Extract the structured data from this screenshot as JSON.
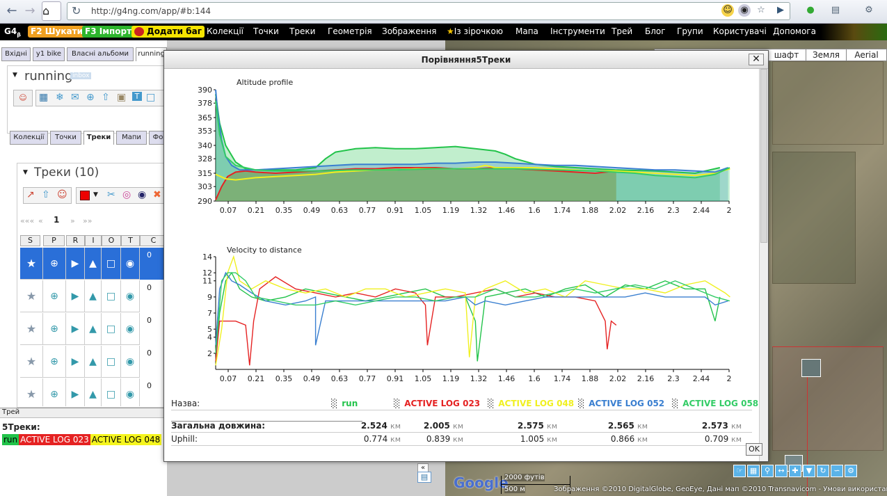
{
  "browser": {
    "url": "http://g4ng.com/app/#b:144"
  },
  "menubar": {
    "logo": "G4",
    "logo_sub": "β",
    "search_badge": "F2 Шукати",
    "import_badge": "F3 Імпорт",
    "bug_badge": "Додати баг",
    "items": [
      "Колекції",
      "Точки",
      "Треки",
      "Геометрія",
      "Зображення",
      "Із зірочкою",
      "Мапа",
      "Інструменти",
      "Трей",
      "Блог",
      "Групи",
      "Користувачі",
      "Допомога"
    ]
  },
  "left": {
    "top_tabs": [
      "Вхідні",
      "y1 bike",
      "Власні альбоми",
      "running"
    ],
    "album_title": "running",
    "album_tag": "inbox",
    "sub_tabs": [
      "Колекції",
      "Точки",
      "Треки",
      "Мапи",
      "Фо"
    ],
    "tracks_title": "Треки (10)",
    "pager": {
      "first": "«««",
      "prev": "«",
      "page": "1",
      "next": "»",
      "last": "»»"
    },
    "columns": [
      "S",
      "P",
      "R",
      "I",
      "O",
      "T",
      "C"
    ],
    "rows": [
      {
        "c": "0"
      },
      {
        "c": "0"
      },
      {
        "c": "0"
      },
      {
        "c": "0"
      },
      {
        "c": "0"
      }
    ]
  },
  "tray": {
    "header": "Трей",
    "title": "5Треки:",
    "chips": [
      {
        "label": "run",
        "color": "#22c34a"
      },
      {
        "label": "ACTIVE LOG 023",
        "color": "#e52222"
      },
      {
        "label": "ACTIVE LOG 048",
        "color": "#f5f51e"
      }
    ]
  },
  "map": {
    "types": [
      "шафт",
      "Земля",
      "Aerial"
    ],
    "scale_ft": "2000 футів",
    "scale_m": "500 м",
    "copyright": "Зображення ©2010 DigitalGlobe, GeoEye, Дані мап ©2010 Transnavicom - Умови використання",
    "google": "Google"
  },
  "dialog": {
    "title": "Порівняння5Треки",
    "close_glyph": "✕",
    "ok_label": "OK",
    "name_label": "Назва:",
    "length_label": "Загальна довжина:",
    "uphill_label": "Uphill:",
    "tracks": [
      {
        "name": "run",
        "color": "#22c34a",
        "length": "2.524",
        "length_unit": "км",
        "uphill": "0.774",
        "uphill_unit": "км"
      },
      {
        "name": "ACTIVE LOG 023",
        "color": "#e52222",
        "length": "2.005",
        "length_unit": "км",
        "uphill": "0.839",
        "uphill_unit": "км"
      },
      {
        "name": "ACTIVE LOG 048",
        "color": "#f0f020",
        "length": "2.575",
        "length_unit": "км",
        "uphill": "1.005",
        "uphill_unit": "км"
      },
      {
        "name": "ACTIVE LOG 052",
        "color": "#3a7fd0",
        "length": "2.565",
        "length_unit": "км",
        "uphill": "0.866",
        "uphill_unit": "км"
      },
      {
        "name": "ACTIVE LOG 058",
        "color": "#33cc66",
        "length": "2.573",
        "length_unit": "км",
        "uphill": "0.709",
        "uphill_unit": "км"
      }
    ]
  },
  "chart_data": [
    {
      "type": "line",
      "title": "Altitude profile",
      "xlim": [
        0,
        2.57
      ],
      "ylim": [
        290,
        390
      ],
      "yticks": [
        290,
        303,
        315,
        328,
        340,
        353,
        365,
        378,
        390
      ],
      "xticks": [
        "0.07",
        "0.21",
        "0.35",
        "0.49",
        "0.63",
        "0.77",
        "0.91",
        "1.05",
        "1.19",
        "1.32",
        "1.46",
        "1.6",
        "1.74",
        "1.88",
        "2.02",
        "2.16",
        "2.3",
        "2.44",
        "2"
      ],
      "series": [
        {
          "name": "run",
          "color": "#22c34a",
          "fill": true,
          "x": [
            0,
            0.02,
            0.05,
            0.1,
            0.15,
            0.2,
            0.3,
            0.4,
            0.5,
            0.55,
            0.6,
            0.7,
            0.8,
            0.9,
            1.0,
            1.1,
            1.2,
            1.3,
            1.4,
            1.45,
            1.5,
            1.6,
            1.7,
            1.8,
            1.9,
            2.0,
            2.2,
            2.4,
            2.524
          ],
          "y": [
            386,
            360,
            340,
            325,
            319,
            318,
            318,
            318,
            320,
            328,
            334,
            337,
            338,
            337,
            337,
            338,
            339,
            337,
            335,
            332,
            328,
            323,
            321,
            320,
            319,
            318,
            317,
            315,
            320
          ]
        },
        {
          "name": "ACTIVE LOG 023",
          "color": "#e52222",
          "fill": false,
          "x": [
            0,
            0.03,
            0.06,
            0.1,
            0.15,
            0.2,
            0.3,
            0.4,
            0.5,
            0.6,
            0.7,
            0.8,
            0.9,
            1.0,
            1.1,
            1.2,
            1.3,
            1.4,
            1.5,
            1.6,
            1.7,
            1.8,
            1.9,
            2.005
          ],
          "y": [
            291,
            303,
            312,
            316,
            317,
            316,
            315,
            316,
            317,
            318,
            319,
            319,
            320,
            320,
            320,
            319,
            319,
            320,
            319,
            318,
            317,
            316,
            315,
            317
          ]
        },
        {
          "name": "ACTIVE LOG 048",
          "color": "#f0f020",
          "fill": false,
          "x": [
            0,
            0.05,
            0.1,
            0.15,
            0.2,
            0.3,
            0.4,
            0.5,
            0.6,
            0.7,
            0.8,
            0.9,
            1.0,
            1.1,
            1.2,
            1.3,
            1.35,
            1.4,
            1.5,
            1.6,
            1.7,
            1.8,
            1.9,
            2.0,
            2.1,
            2.2,
            2.3,
            2.4,
            2.5,
            2.575
          ],
          "y": [
            314,
            310,
            309,
            310,
            311,
            312,
            313,
            314,
            316,
            317,
            318,
            318,
            319,
            319,
            319,
            320,
            322,
            320,
            320,
            320,
            319,
            318,
            317,
            317,
            316,
            315,
            314,
            313,
            315,
            319
          ]
        },
        {
          "name": "ACTIVE LOG 052",
          "color": "#3a7fd0",
          "fill": true,
          "x": [
            0,
            0.01,
            0.03,
            0.05,
            0.08,
            0.12,
            0.2,
            0.3,
            0.4,
            0.5,
            0.6,
            0.7,
            0.8,
            0.9,
            1.0,
            1.1,
            1.2,
            1.3,
            1.4,
            1.5,
            1.6,
            1.7,
            1.8,
            1.9,
            2.0,
            2.1,
            2.2,
            2.3,
            2.4,
            2.5,
            2.565
          ],
          "y": [
            390,
            370,
            345,
            330,
            322,
            318,
            318,
            319,
            320,
            321,
            322,
            323,
            323,
            323,
            323,
            324,
            324,
            325,
            325,
            324,
            323,
            322,
            322,
            321,
            320,
            319,
            318,
            318,
            317,
            316,
            320
          ]
        },
        {
          "name": "ACTIVE LOG 058",
          "color": "#33cc66",
          "fill": true,
          "x": [
            0,
            0.02,
            0.05,
            0.1,
            0.2,
            0.3,
            0.5,
            0.7,
            0.9,
            1.1,
            1.3,
            1.5,
            1.7,
            1.9,
            2.0,
            2.1,
            2.2,
            2.3,
            2.4,
            2.5,
            2.573
          ],
          "y": [
            380,
            350,
            330,
            322,
            318,
            317,
            317,
            318,
            318,
            319,
            319,
            319,
            318,
            317,
            316,
            315,
            313,
            312,
            311,
            314,
            320
          ]
        }
      ]
    },
    {
      "type": "line",
      "title": "Velocity to distance",
      "xlim": [
        0,
        2.57
      ],
      "ylim": [
        0,
        14
      ],
      "yticks": [
        2,
        4,
        5,
        7,
        9,
        11,
        12,
        14
      ],
      "xticks": [
        "0.07",
        "0.21",
        "0.35",
        "0.49",
        "0.63",
        "0.77",
        "0.91",
        "1.05",
        "1.19",
        "1.32",
        "1.46",
        "1.6",
        "1.74",
        "1.88",
        "2.02",
        "2.16",
        "2.3",
        "2.44",
        "2"
      ],
      "series": [
        {
          "name": "run",
          "color": "#22c34a",
          "x": [
            0,
            0.02,
            0.05,
            0.08,
            0.12,
            0.18,
            0.25,
            0.35,
            0.45,
            0.55,
            0.65,
            0.75,
            0.85,
            0.95,
            1.05,
            1.15,
            1.25,
            1.3,
            1.31,
            1.35,
            1.45,
            1.55,
            1.65,
            1.75,
            1.85,
            1.95,
            2.05,
            2.15,
            2.25,
            2.35,
            2.45,
            2.5,
            2.524
          ],
          "y": [
            1,
            7,
            11,
            12,
            10,
            9,
            8.5,
            9,
            10,
            9.5,
            9,
            8.5,
            9,
            9.5,
            10,
            9,
            9,
            6,
            1,
            9,
            9.5,
            10,
            9,
            10,
            10.5,
            9,
            10.5,
            10,
            11,
            10,
            10,
            6,
            9
          ]
        },
        {
          "name": "ACTIVE LOG 023",
          "color": "#e52222",
          "x": [
            0,
            0.02,
            0.05,
            0.1,
            0.15,
            0.17,
            0.19,
            0.22,
            0.3,
            0.4,
            0.5,
            0.6,
            0.7,
            0.8,
            0.9,
            1.0,
            1.05,
            1.06,
            1.1,
            1.2,
            1.3,
            1.4,
            1.5,
            1.6,
            1.7,
            1.8,
            1.9,
            1.95,
            1.96,
            1.98,
            2.005
          ],
          "y": [
            1,
            6,
            6,
            6,
            5.5,
            0.5,
            6,
            10,
            11.5,
            10,
            9.5,
            9,
            9.5,
            9,
            10,
            9.5,
            8,
            3,
            9,
            9,
            9.5,
            10,
            9,
            9.5,
            9,
            9,
            8.5,
            6,
            2.5,
            6,
            5.5
          ]
        },
        {
          "name": "ACTIVE LOG 048",
          "color": "#f0f020",
          "x": [
            0,
            0.03,
            0.06,
            0.09,
            0.12,
            0.18,
            0.25,
            0.35,
            0.45,
            0.55,
            0.65,
            0.75,
            0.85,
            0.95,
            1.05,
            1.15,
            1.25,
            1.27,
            1.3,
            1.35,
            1.45,
            1.55,
            1.65,
            1.75,
            1.85,
            1.95,
            2.05,
            2.15,
            2.25,
            2.35,
            2.45,
            2.55,
            2.575
          ],
          "y": [
            0.5,
            5,
            12,
            14,
            11,
            10,
            11,
            10,
            9.5,
            10,
            9,
            10,
            10,
            9,
            9.5,
            10,
            9.5,
            1.5,
            9,
            10,
            11,
            9.5,
            10,
            9,
            11,
            10.5,
            10,
            10,
            9.5,
            10.5,
            11,
            9.5,
            9
          ]
        },
        {
          "name": "ACTIVE LOG 052",
          "color": "#3a7fd0",
          "x": [
            0,
            0.02,
            0.05,
            0.08,
            0.12,
            0.18,
            0.25,
            0.35,
            0.45,
            0.5,
            0.5,
            0.55,
            0.65,
            0.75,
            0.85,
            0.95,
            1.05,
            1.15,
            1.25,
            1.3,
            1.35,
            1.45,
            1.55,
            1.65,
            1.75,
            1.85,
            1.95,
            2.05,
            2.15,
            2.25,
            2.35,
            2.45,
            2.5,
            2.565
          ],
          "y": [
            3,
            10,
            12,
            11,
            10.5,
            9.5,
            8.5,
            8,
            8.5,
            9,
            3,
            8.5,
            8.5,
            8.5,
            8.5,
            8.5,
            8.5,
            8.5,
            9,
            8,
            8.5,
            8,
            8.5,
            9,
            9,
            9,
            9,
            9,
            9.5,
            9,
            9,
            9,
            8,
            8.5
          ]
        },
        {
          "name": "ACTIVE LOG 058",
          "color": "#33cc66",
          "x": [
            0,
            0.03,
            0.06,
            0.1,
            0.15,
            0.2,
            0.3,
            0.4,
            0.5,
            0.6,
            0.7,
            0.8,
            0.9,
            1.0,
            1.1,
            1.2,
            1.3,
            1.4,
            1.5,
            1.6,
            1.7,
            1.8,
            1.9,
            2.0,
            2.1,
            2.2,
            2.3,
            2.4,
            2.5,
            2.573
          ],
          "y": [
            2,
            11,
            12,
            12,
            11,
            9,
            8.5,
            8,
            8,
            8.5,
            8,
            8.5,
            9,
            9,
            8.5,
            9,
            9,
            10,
            9,
            9,
            9.5,
            10,
            9.5,
            10,
            10.5,
            10,
            11,
            10,
            9,
            8.5
          ]
        }
      ]
    }
  ]
}
